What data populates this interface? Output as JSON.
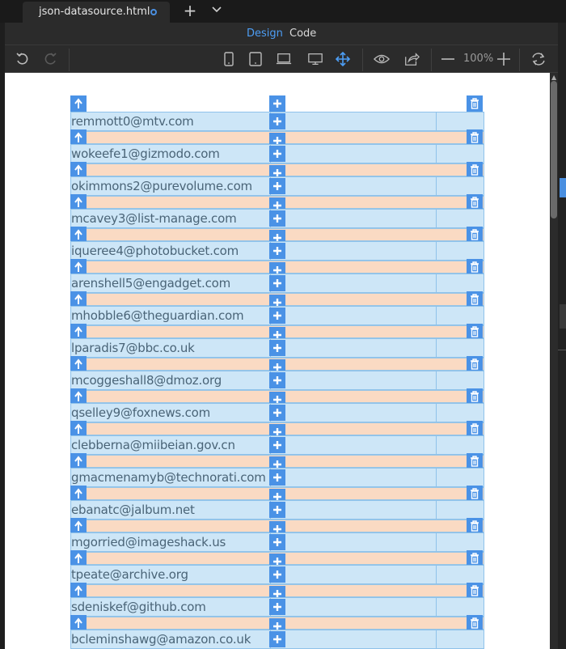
{
  "tab": {
    "title": "json-datasource.html",
    "new_tab": "+",
    "menu": "⌄"
  },
  "modes": {
    "design": "Design",
    "code": "Code"
  },
  "toolbar": {
    "zoom": "100%"
  },
  "colors": {
    "accent": "#4a8fe0",
    "row_bg": "#cde6f7",
    "gap_bg": "#fadac3",
    "handle_bg": "#4a92e6"
  },
  "emails": [
    "remmott0@mtv.com",
    "wokeefe1@gizmodo.com",
    "okimmons2@purevolume.com",
    "mcavey3@list-manage.com",
    "iqueree4@photobucket.com",
    "arenshell5@engadget.com",
    "mhobble6@theguardian.com",
    "lparadis7@bbc.co.uk",
    "mcoggeshall8@dmoz.org",
    "qselley9@foxnews.com",
    "clebberna@miibeian.gov.cn",
    "gmacmenamyb@technorati.com",
    "ebanatc@jalbum.net",
    "mgorried@imageshack.us",
    "tpeate@archive.org",
    "sdeniskef@github.com",
    "bcleminshawg@amazon.co.uk"
  ]
}
